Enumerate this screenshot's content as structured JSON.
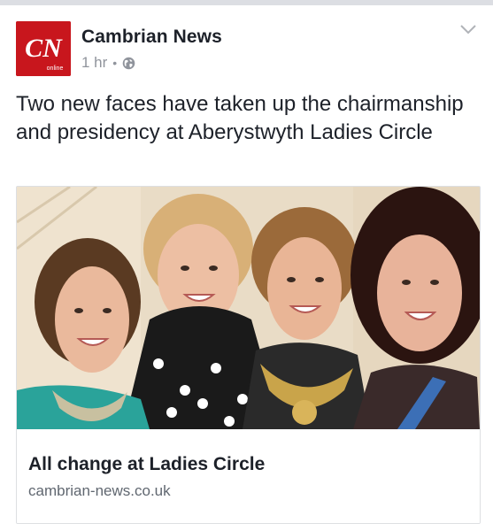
{
  "post": {
    "page_name": "Cambrian News",
    "avatar": {
      "logo_text": "CN",
      "logo_subtext": "online",
      "color": "#c8161d"
    },
    "timestamp": "1 hr",
    "separator": "•",
    "privacy_icon": "globe-icon",
    "menu_icon": "chevron-down-icon",
    "text": "Two new faces have taken up the chairmanship and presidency at Aberystwyth Ladies Circle"
  },
  "link_preview": {
    "title": "All change at Ladies Circle",
    "domain": "cambrian-news.co.uk"
  }
}
